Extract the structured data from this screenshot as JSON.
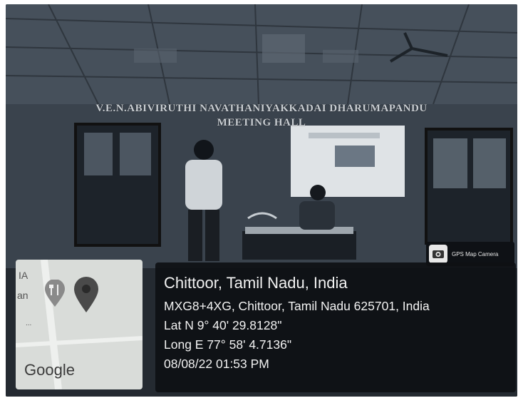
{
  "photo": {
    "sign_line1": "V.E.N.ABIVIRUTHI NAVATHANIYAKKADAI DHARUMAPANDU",
    "sign_line2": "MEETING HALL"
  },
  "badge": {
    "label": "GPS Map Camera",
    "icon": "camera-icon"
  },
  "map": {
    "fragment_top": "IA",
    "fragment_mid": "an",
    "fragment_dots": "...",
    "logo": "Google",
    "poi_icon": "restaurant-icon",
    "pin_icon": "location-pin-icon",
    "pin_color": "#4a4a4a"
  },
  "location": {
    "city": "Chittoor, Tamil Nadu, India",
    "address": "MXG8+4XG, Chittoor, Tamil Nadu 625701, India",
    "lat": "Lat N 9° 40' 29.8128\"",
    "long": "Long E 77° 58' 4.7136\"",
    "datetime": "08/08/22 01:53 PM"
  },
  "colors": {
    "overlay_bg": "#0e1014",
    "text": "#f2f2f2",
    "map_bg": "#d9dcd9"
  }
}
